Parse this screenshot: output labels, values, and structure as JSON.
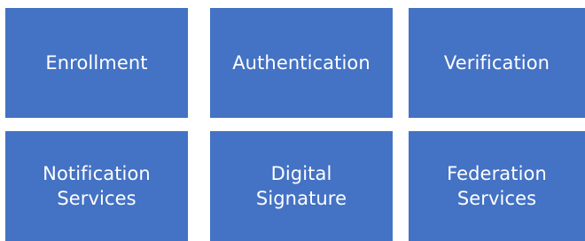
{
  "tiles": [
    {
      "label": "Enrollment"
    },
    {
      "label": "Authentication"
    },
    {
      "label": "Verification"
    },
    {
      "label": "Notification\nServices"
    },
    {
      "label": "Digital\nSignature"
    },
    {
      "label": "Federation\nServices"
    }
  ],
  "colors": {
    "tile_fill": "#4472c4",
    "tile_text": "#ffffff",
    "background": "#ffffff"
  }
}
